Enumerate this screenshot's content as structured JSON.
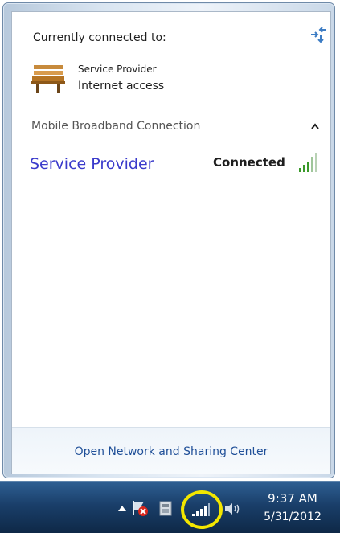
{
  "panel": {
    "connected_to_label": "Currently connected to:",
    "current": {
      "name": "Service Provider",
      "access": "Internet access",
      "icon": "bench-network-icon"
    },
    "section_title": "Mobile Broadband Connection",
    "connections": [
      {
        "name": "Service Provider",
        "status": "Connected",
        "icon": "signal-strength-icon"
      }
    ],
    "footer_link": "Open Network and Sharing Center"
  },
  "taskbar": {
    "icons": [
      "show-hidden-icons-arrow",
      "action-center-flag-icon",
      "device-icon",
      "mobile-broadband-signal-icon",
      "speaker-icon"
    ],
    "highlight_color": "#f3e600",
    "time": "9:37 AM",
    "date": "5/31/2012"
  },
  "colors": {
    "link": "#3a3acb",
    "footer_link": "#1f4f98",
    "signal_green": "#3a9a2a"
  }
}
